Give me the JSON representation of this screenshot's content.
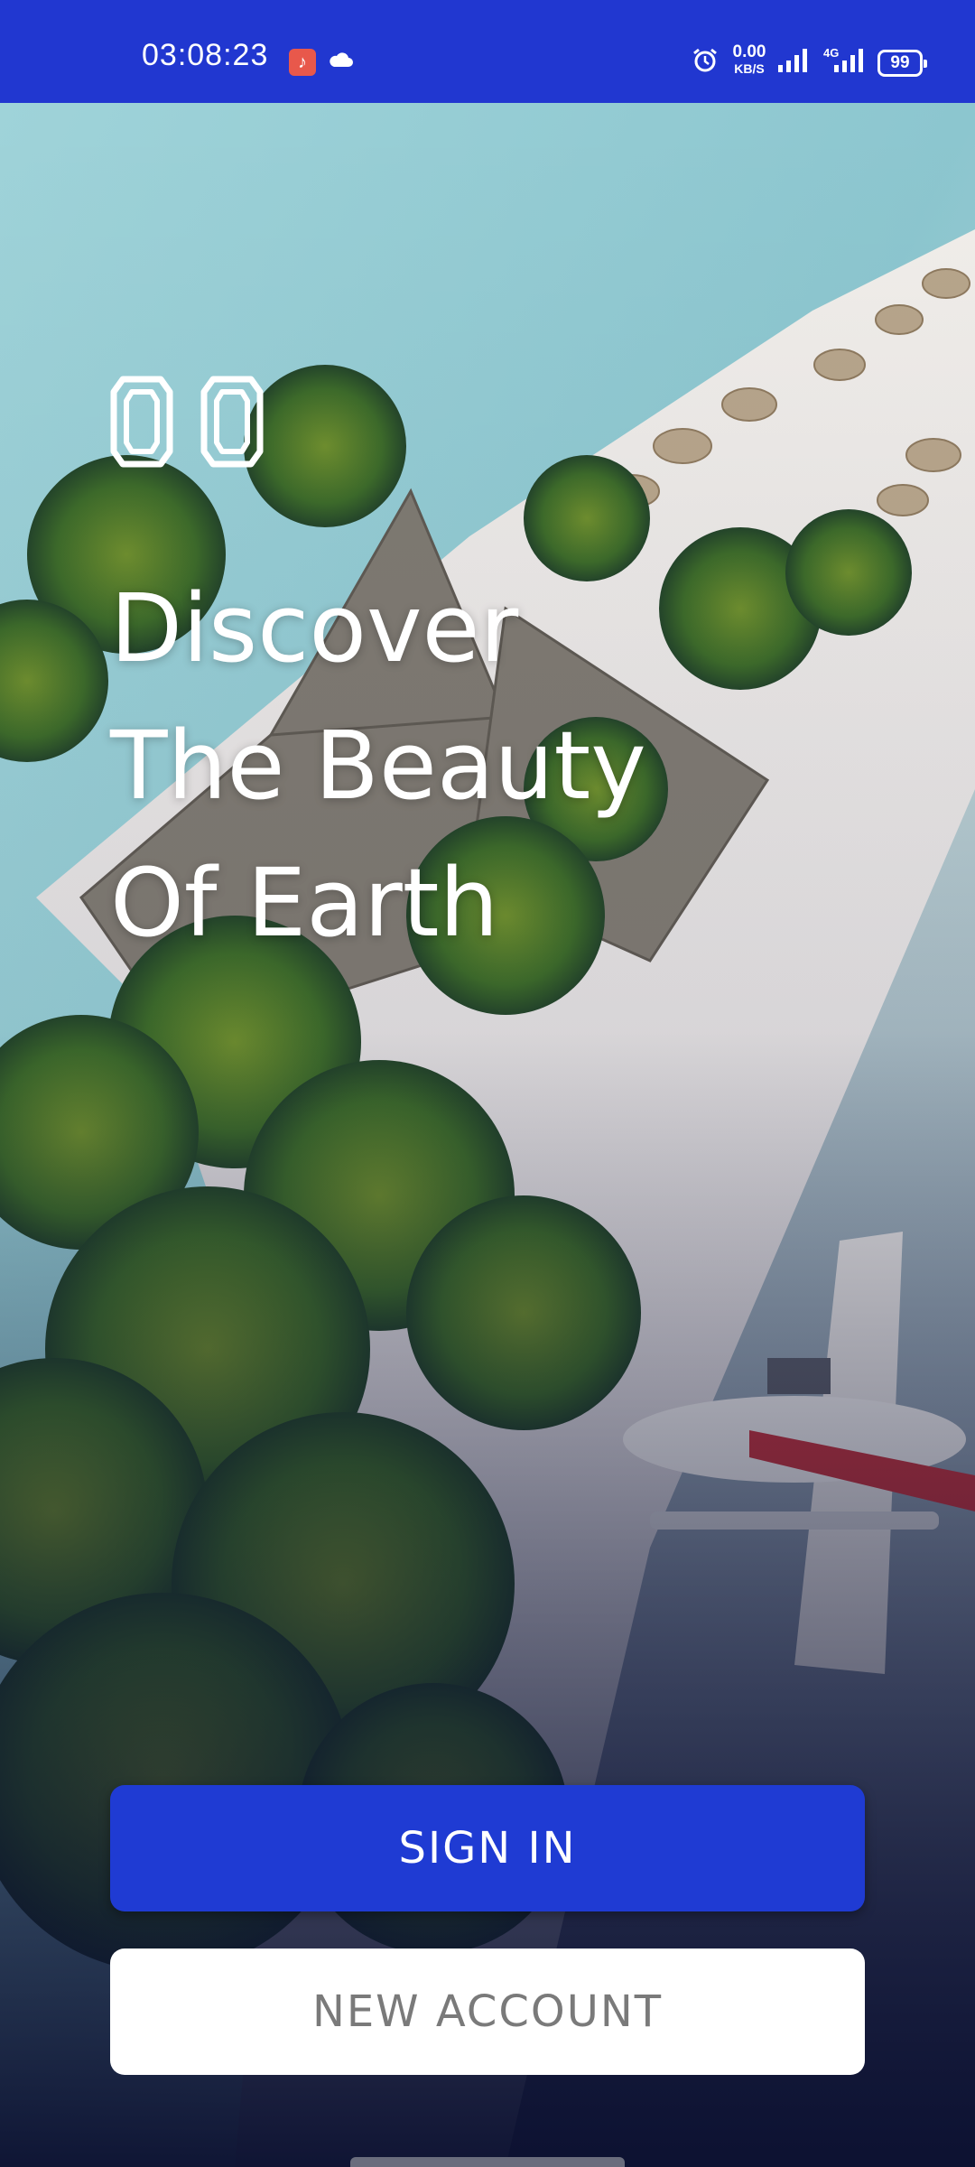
{
  "status_bar": {
    "time": "03:08:23",
    "net_speed_value": "0.00",
    "net_speed_unit": "KB/S",
    "network_type": "4G",
    "battery": "99",
    "background_color": "#2137d0",
    "icons": [
      "music-app-icon",
      "cloud-icon",
      "alarm-icon",
      "signal-icon",
      "signal-4g-icon",
      "battery-icon"
    ]
  },
  "hero": {
    "logo_icon": "double-zero-logo",
    "headline_lines": [
      "Discover",
      "The Beauty",
      "Of Earth"
    ]
  },
  "actions": {
    "sign_in_label": "SIGN IN",
    "new_account_label": "NEW ACCOUNT",
    "accent_color": "#1f3bd3"
  }
}
